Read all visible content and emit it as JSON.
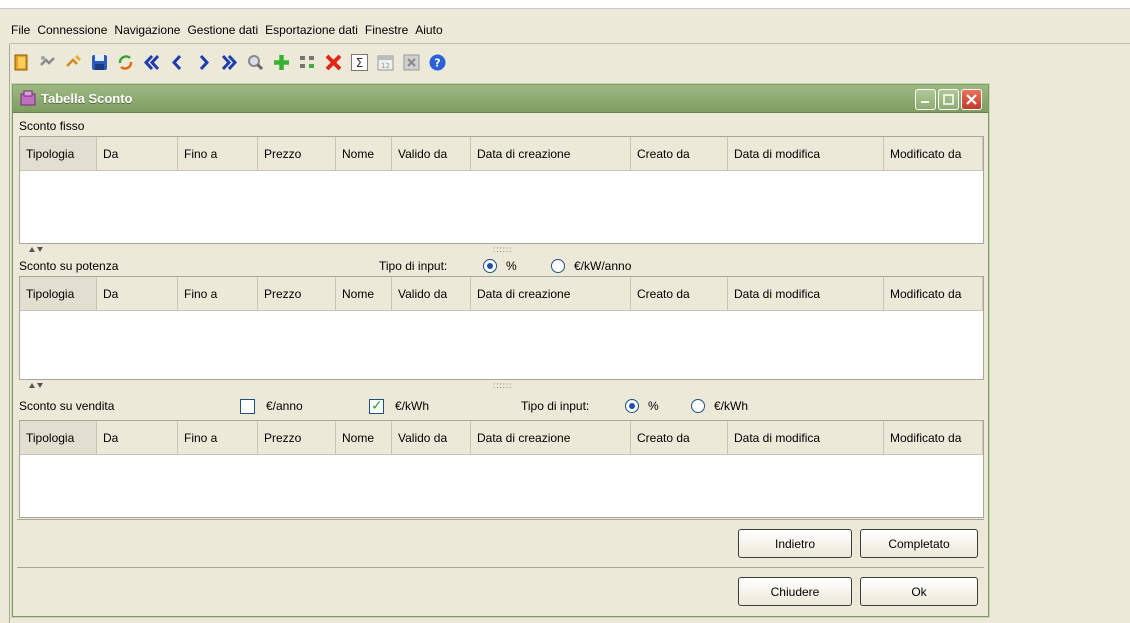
{
  "menu": [
    "File",
    "Connessione",
    "Navigazione",
    "Gestione dati",
    "Esportazione dati",
    "Finestre",
    "Aiuto"
  ],
  "toolbar_icons": [
    "exit-icon",
    "connect-icon",
    "disconnect-icon",
    "save-icon",
    "refresh-icon",
    "first-icon",
    "previous-icon",
    "next-icon",
    "last-icon",
    "search-icon",
    "add-icon",
    "tree-icon",
    "delete-icon",
    "sum-icon",
    "calendar-icon",
    "excel-icon",
    "help-icon"
  ],
  "window": {
    "title": "Tabella Sconto"
  },
  "columns": [
    "Tipologia",
    "Da",
    "Fino a",
    "Prezzo",
    "Nome",
    "Valido da",
    "Data di creazione",
    "Creato da",
    "Data di modifica",
    "Modificato da"
  ],
  "sections": {
    "fisso": {
      "label": "Sconto fisso"
    },
    "potenza": {
      "label": "Sconto su potenza",
      "input_label": "Tipo di input:",
      "option_pct": "%",
      "option_kw": "€/kW/anno",
      "selected": "%"
    },
    "vendita": {
      "label": "Sconto su vendita",
      "check_anno": "€/anno",
      "check_anno_checked": false,
      "check_kwh": "€/kWh",
      "check_kwh_checked": true,
      "input_label": "Tipo di input:",
      "option_pct": "%",
      "option_kwh": "€/kWh",
      "selected": "%"
    }
  },
  "buttons": {
    "back": "Indietro",
    "done": "Completato",
    "close": "Chiudere",
    "ok": "Ok"
  },
  "colors": {
    "titlebar": "#8aa96e",
    "accent_radio": "#1c52a8",
    "check": "#22a022",
    "close_button": "#c0392b"
  }
}
